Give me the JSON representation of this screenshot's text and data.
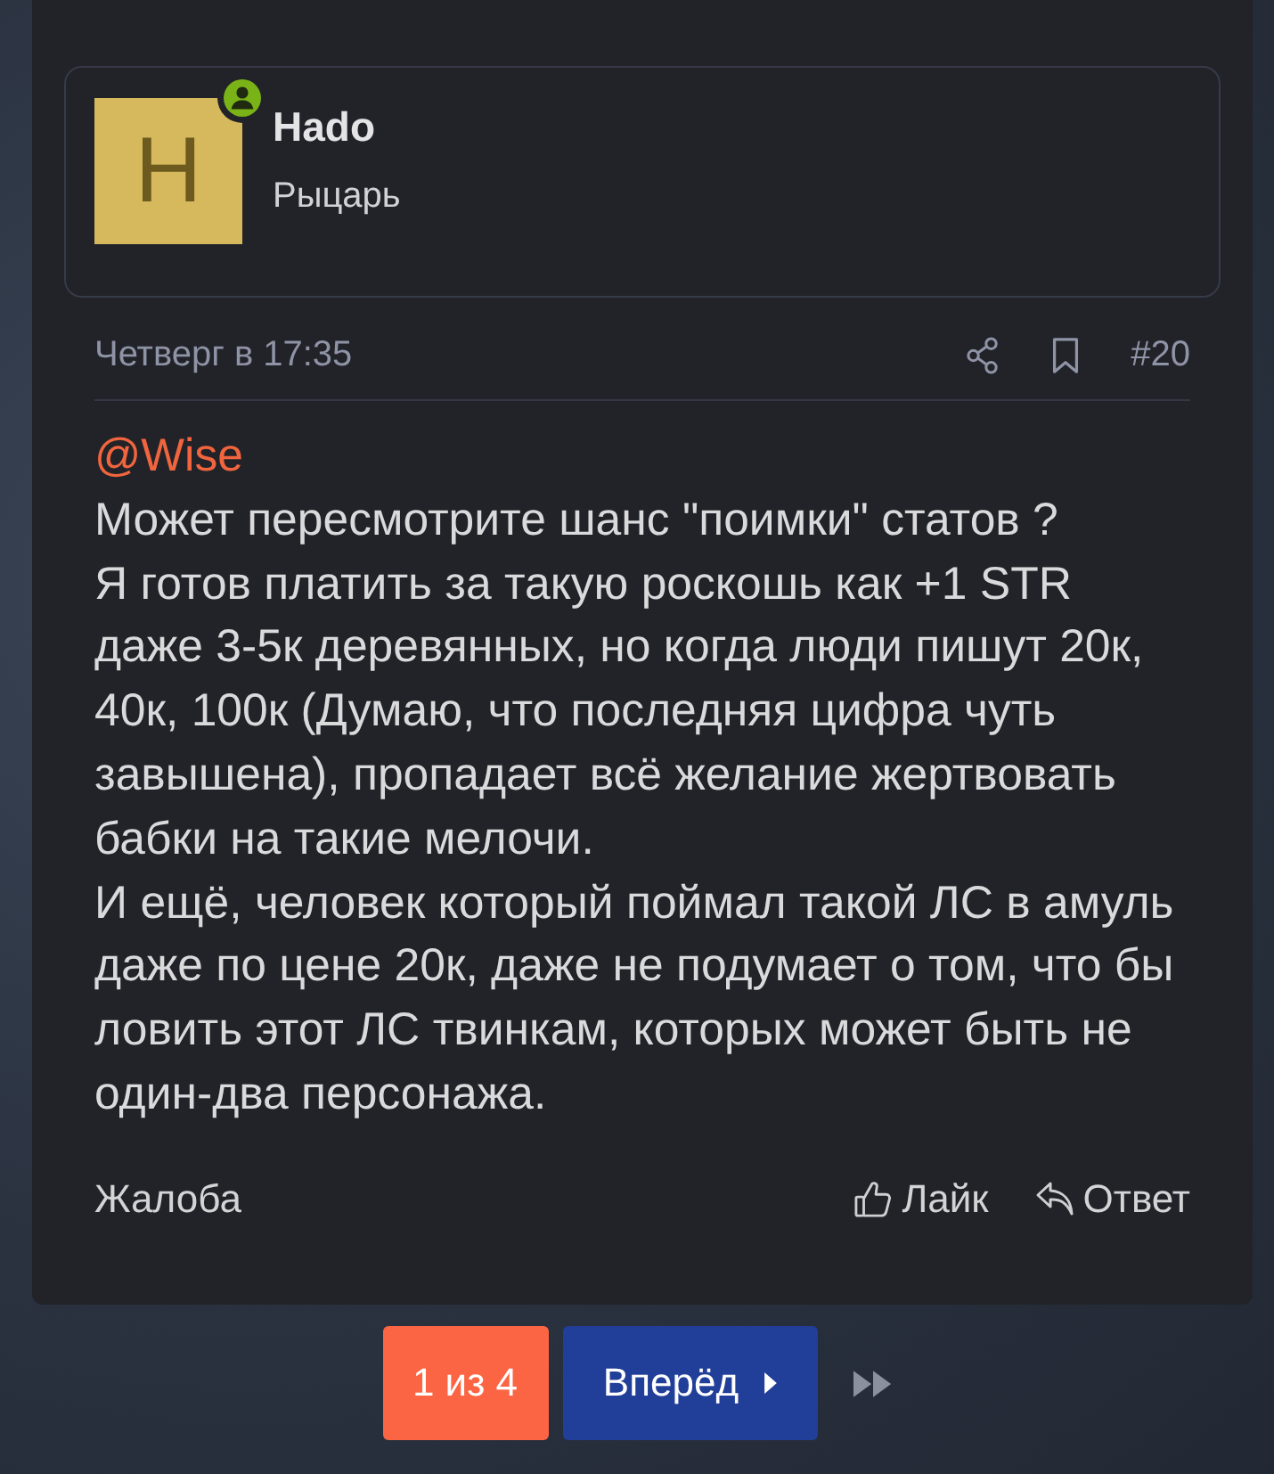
{
  "author": {
    "avatar_letter": "H",
    "online": true,
    "name": "Hado",
    "title": "Рыцарь"
  },
  "post": {
    "date": "Четверг в 17:35",
    "number": "#20",
    "mention": "@Wise",
    "paragraphs": [
      "Может пересмотрите шанс \"поимки\" статов ?",
      "Я готов платить за такую роскошь как +1 STR даже 3-5к деревянных, но когда люди пишут 20к, 40к, 100к (Думаю, что последняя цифра чуть завышена), пропадает всё желание жертвовать бабки на такие мелочи.",
      "И ещё, человек который поймал такой ЛС в амуль даже по цене 20к, даже не подумает о том, что бы ловить этот ЛС твинкам, которых может быть не один-два персонажа."
    ]
  },
  "actions": {
    "report": "Жалоба",
    "like": "Лайк",
    "reply": "Ответ"
  },
  "pagination": {
    "current": "1 из 4",
    "next": "Вперёд"
  }
}
